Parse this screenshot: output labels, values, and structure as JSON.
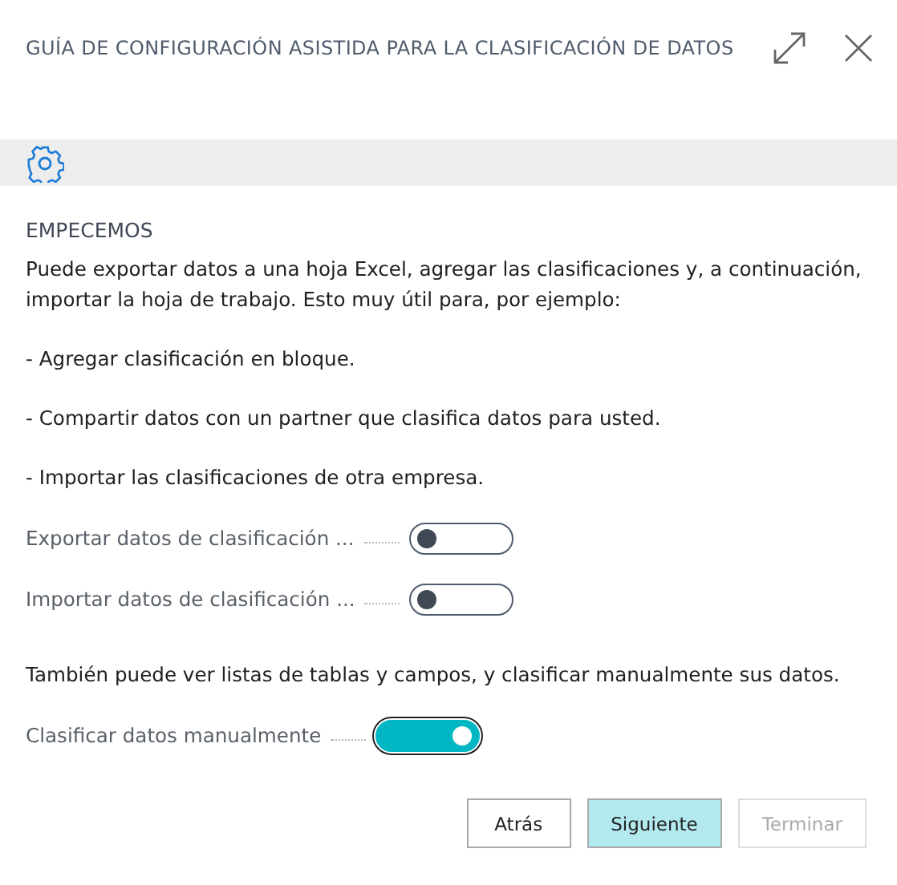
{
  "window": {
    "title": "GUÍA DE CONFIGURACIÓN ASISTIDA PARA LA CLASIFICACIÓN DE DATOS"
  },
  "section": {
    "heading": "EMPECEMOS",
    "intro": "Puede exportar datos a una hoja Excel, agregar las clasificaciones y, a continuación, importar la hoja de trabajo. Esto muy útil para, por ejemplo:",
    "bullets": [
      "- Agregar clasificación en bloque.",
      "- Compartir datos con un partner que clasifica datos para usted.",
      "- Importar las clasificaciones de otra empresa."
    ]
  },
  "toggles": [
    {
      "label": "Exportar datos de clasificación ...",
      "on": false,
      "focused": false
    },
    {
      "label": "Importar datos de clasificación ...",
      "on": false,
      "focused": false
    }
  ],
  "note": "También puede ver listas de tablas y campos, y clasificar manualmente sus datos.",
  "toggles2": [
    {
      "label": "Clasificar datos manualmente",
      "on": true,
      "focused": true
    }
  ],
  "buttons": [
    {
      "label": "Atrás",
      "primary": false,
      "disabled": false
    },
    {
      "label": "Siguiente",
      "primary": true,
      "disabled": false
    },
    {
      "label": "Terminar",
      "primary": false,
      "disabled": true
    }
  ]
}
